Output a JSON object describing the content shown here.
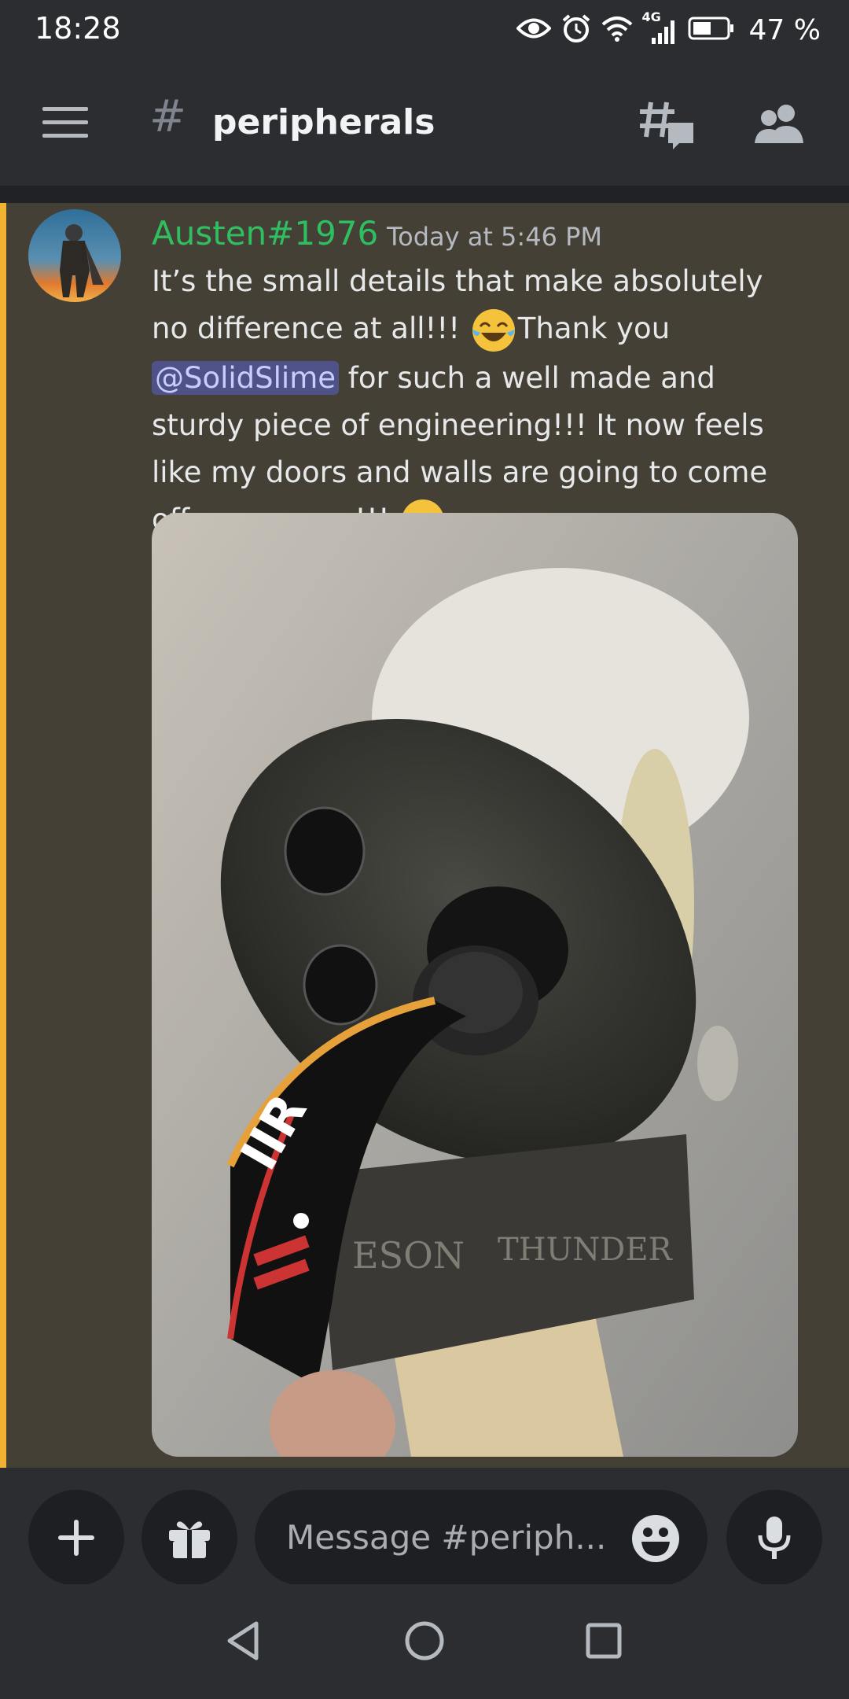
{
  "status_bar": {
    "time": "18:28",
    "network": "4G",
    "battery_percent": "47 %"
  },
  "header": {
    "channel_hash": "#",
    "channel_name": "peripherals"
  },
  "message": {
    "author": "Austen#1976",
    "timestamp": "Today at 5:46 PM",
    "text_1": "It’s the small details that make absolutely no difference at all!!!",
    "emoji_1": "joy-emoji",
    "text_2": "Thank you",
    "mention": "@SolidSlime",
    "text_3": "for such a well made and sturdy piece of engineering!!! It now feels like my doors and walls are going to come off worse now!!!",
    "emoji_2": "sunglasses-emoji",
    "photo_text": {
      "strap_letters": "IIR",
      "label_1": "ESON",
      "label_2": "THUNDER"
    }
  },
  "composer": {
    "placeholder": "Message #periph..."
  },
  "colors": {
    "background": "#2b2d31",
    "highlight": "#444036",
    "highlight_bar": "#f0b232",
    "author": "#2fbf61",
    "mention_bg": "#4e5288"
  }
}
